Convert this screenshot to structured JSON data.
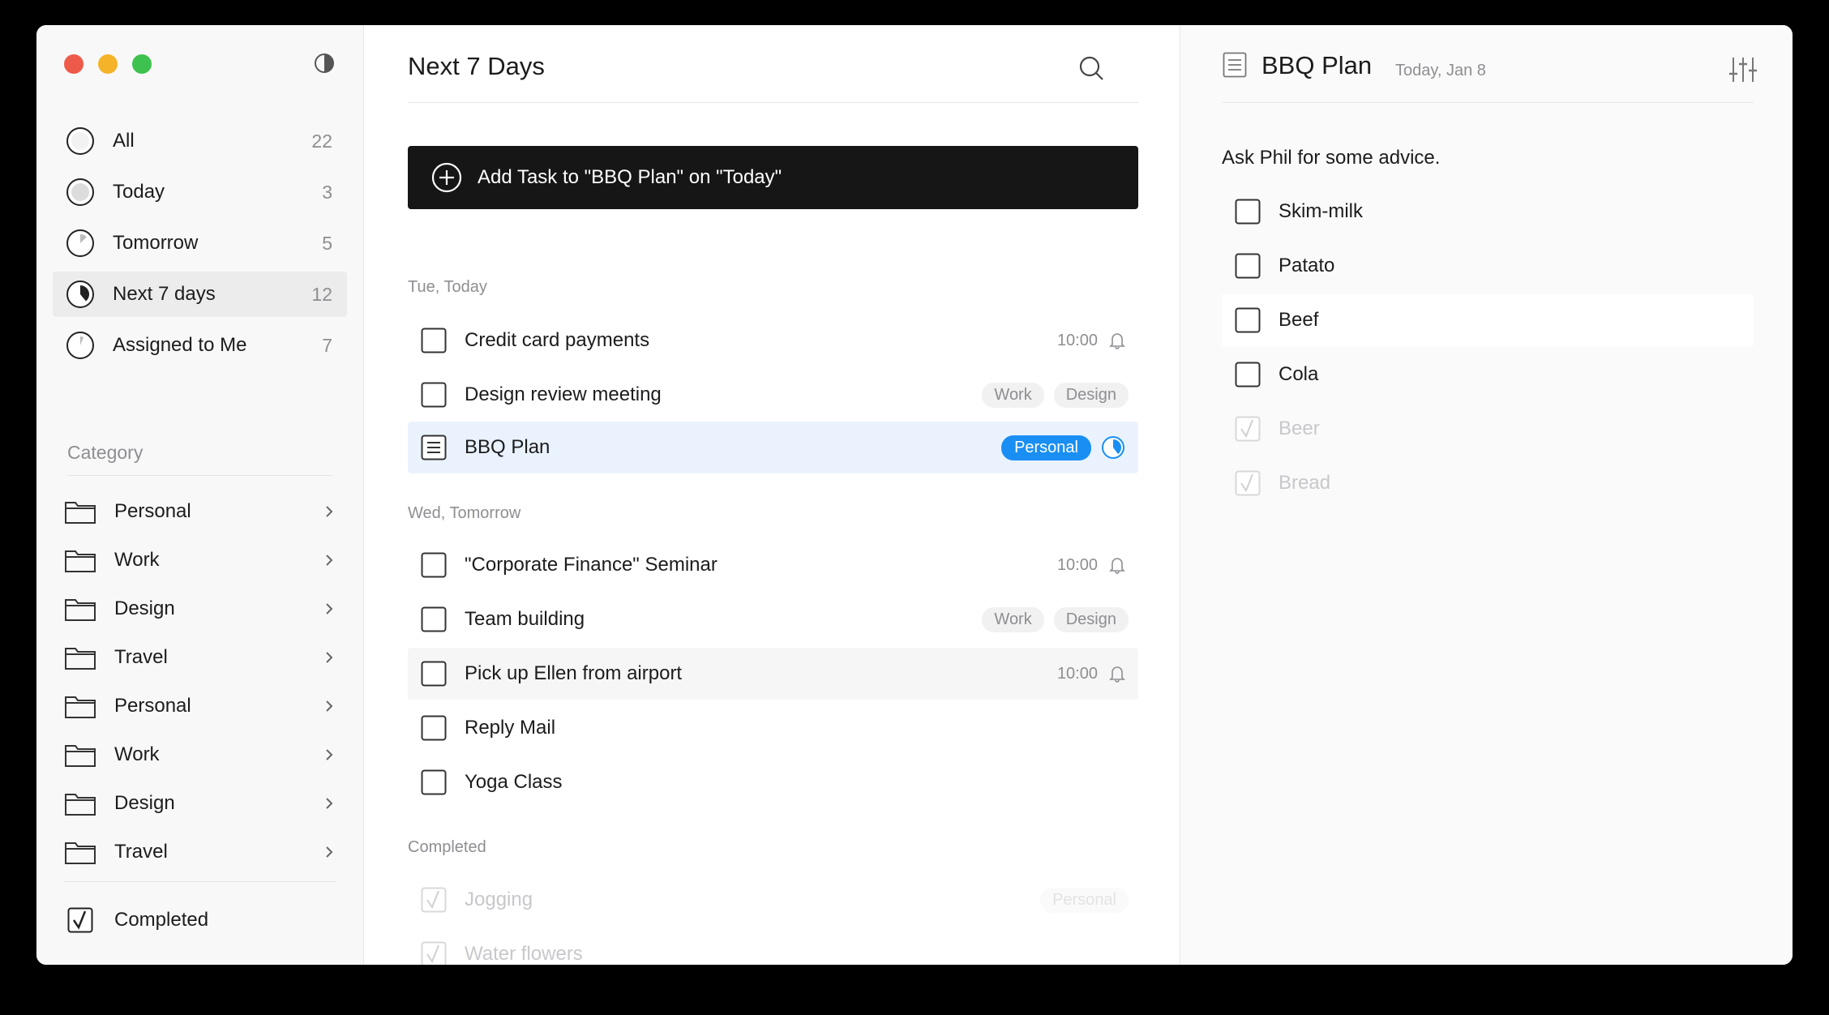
{
  "sidebar": {
    "smart_lists": [
      {
        "label": "All",
        "count": "22"
      },
      {
        "label": "Today",
        "count": "3"
      },
      {
        "label": "Tomorrow",
        "count": "5"
      },
      {
        "label": "Next 7 days",
        "count": "12"
      },
      {
        "label": "Assigned to Me",
        "count": "7"
      }
    ],
    "category_header": "Category",
    "categories": [
      "Personal",
      "Work",
      "Design",
      "Travel",
      "Personal",
      "Work",
      "Design",
      "Travel"
    ],
    "completed_label": "Completed"
  },
  "main": {
    "title": "Next 7 Days",
    "add_task_label": "Add Task to \"BBQ Plan\" on \"Today\"",
    "sections": [
      {
        "label": "Tue, Today",
        "tasks": [
          {
            "title": "Credit card payments",
            "time": "10:00"
          },
          {
            "title": "Design review meeting",
            "tags": [
              "Work",
              "Design"
            ]
          },
          {
            "title": "BBQ Plan",
            "tags": [
              "Personal"
            ]
          }
        ]
      },
      {
        "label": "Wed, Tomorrow",
        "tasks": [
          {
            "title": "\"Corporate Finance\" Seminar",
            "time": "10:00"
          },
          {
            "title": "Team building",
            "tags": [
              "Work",
              "Design"
            ]
          },
          {
            "title": "Pick up Ellen from airport",
            "time": "10:00"
          },
          {
            "title": "Reply Mail"
          },
          {
            "title": "Yoga Class"
          }
        ]
      },
      {
        "label": "Completed",
        "tasks": [
          {
            "title": "Jogging",
            "tags": [
              "Personal"
            ]
          },
          {
            "title": "Water flowers"
          }
        ]
      }
    ]
  },
  "detail": {
    "title": "BBQ Plan",
    "date": "Today, Jan 8",
    "note": "Ask Phil for some advice.",
    "items": [
      {
        "label": "Skim-milk",
        "done": false
      },
      {
        "label": "Patato",
        "done": false
      },
      {
        "label": "Beef",
        "done": false
      },
      {
        "label": "Cola",
        "done": false
      },
      {
        "label": "Beer",
        "done": true
      },
      {
        "label": "Bread",
        "done": true
      }
    ]
  },
  "icons": {
    "close": "traffic-light-red",
    "minimize": "traffic-light-yellow",
    "zoom": "traffic-light-green",
    "theme": "half-circle-icon",
    "search": "search-icon",
    "filter": "sliders-icon"
  },
  "colors": {
    "accent": "#1a8ff3",
    "add_bar": "#161616",
    "selected_row": "#eaf3fd"
  }
}
